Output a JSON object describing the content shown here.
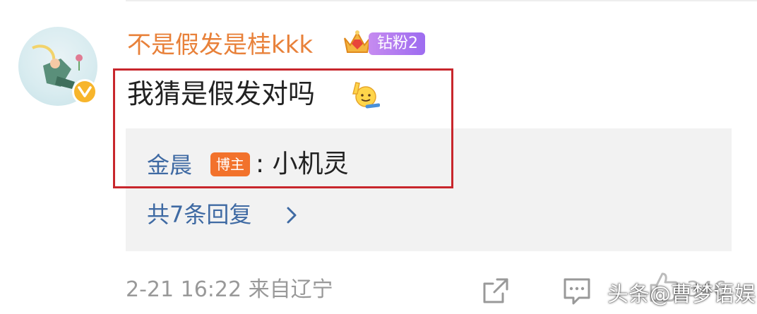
{
  "comment": {
    "username": "不是假发是桂kkk",
    "fan_badge": "钻粉2",
    "text": "我猜是假发对吗",
    "reply": {
      "author": "金晨",
      "badge": "博主",
      "text": ": 小机灵"
    },
    "replies_link": "共7条回复",
    "meta": "2-21 16:22 来自辽宁",
    "like_count": "346"
  },
  "icons": [
    "avatar",
    "verified-icon",
    "crown-icon",
    "wave-emoji-icon",
    "chevron-right-icon",
    "share-icon",
    "comment-icon",
    "thumbs-up-icon"
  ],
  "colors": {
    "username": "#e8813a",
    "link": "#3f6aa3",
    "highlight_border": "#c8262c",
    "blogger_badge": "#f2722c",
    "fan_badge": "#9d6cf0",
    "verified": "#f7b52c"
  },
  "watermark": "头条@曹梦语娱"
}
